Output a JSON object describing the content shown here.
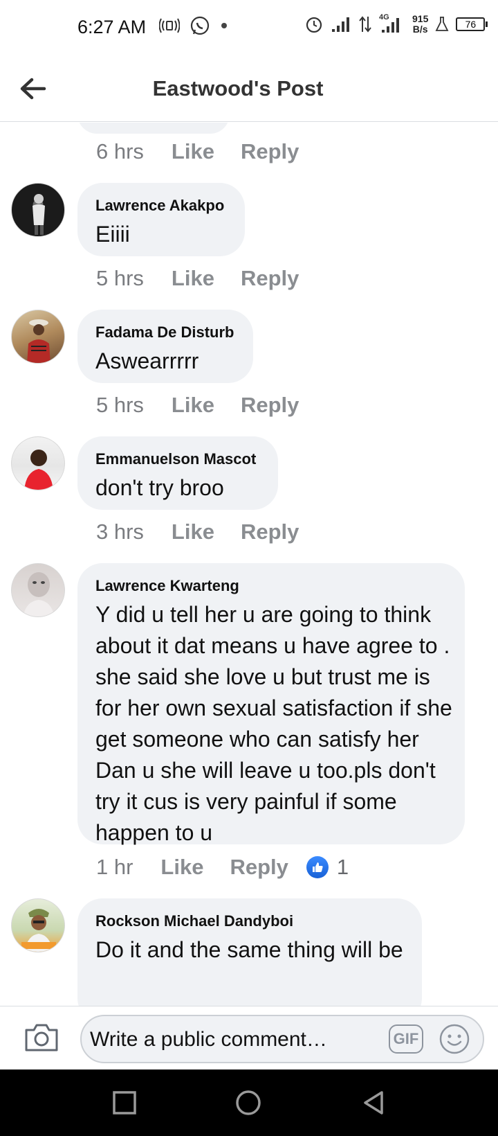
{
  "status_bar": {
    "time": "6:27 AM",
    "net_speed_value": "915",
    "net_speed_unit": "B/s",
    "network_type": "4G",
    "battery": "76"
  },
  "header": {
    "title": "Eastwood's Post",
    "back_icon": "back-arrow-icon"
  },
  "previous_comment_meta": {
    "time": "6 hrs",
    "like": "Like",
    "reply": "Reply"
  },
  "comments": [
    {
      "author": "Lawrence Akakpo",
      "text": "Eiiii",
      "time": "5 hrs",
      "like": "Like",
      "reply": "Reply"
    },
    {
      "author": "Fadama De Disturb",
      "text": "Aswearrrrr",
      "time": "5 hrs",
      "like": "Like",
      "reply": "Reply"
    },
    {
      "author": "Emmanuelson Mascot",
      "text": "don't try broo",
      "time": "3 hrs",
      "like": "Like",
      "reply": "Reply"
    },
    {
      "author": "Lawrence Kwarteng",
      "text": "Y did u tell her u are going to think about it dat means u have agree to . she said she love u but trust me is for her own sexual satisfaction if she get someone who can satisfy her Dan u she will leave u too.pls don't try it cus is very painful if some happen to u",
      "time": "1 hr",
      "like": "Like",
      "reply": "Reply",
      "reaction_count": "1"
    },
    {
      "author": "Rockson Michael Dandyboi",
      "text": "Do it and the same thing will be"
    }
  ],
  "composer": {
    "placeholder": "Write a public comment…",
    "gif_label": "GIF"
  },
  "colors": {
    "bubble": "#f0f2f5",
    "meta_text": "#8a8d91",
    "like_blue": "#1877f2"
  }
}
